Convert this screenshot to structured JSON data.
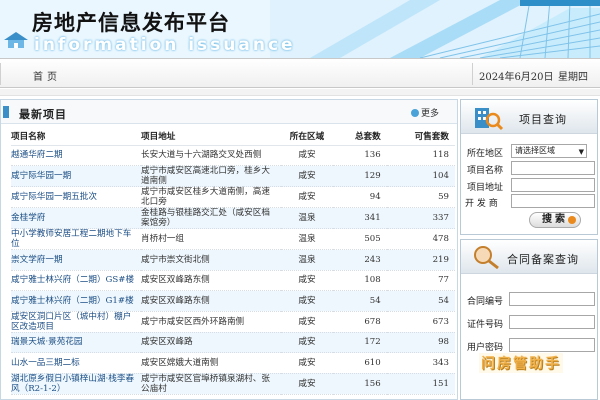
{
  "banner": {
    "title": "房地产信息发布平台",
    "subtitle": "information issuance"
  },
  "nav": {
    "home": "首页",
    "date": "2024年6月20日",
    "weekday": "星期四"
  },
  "projects": {
    "title": "最新项目",
    "more": "更多",
    "columns": [
      "项目名称",
      "项目地址",
      "所在区域",
      "总套数",
      "可售套数"
    ],
    "rows": [
      {
        "name": "越通华府二期",
        "address": "长安大道与十六湖路交叉处西侧",
        "district": "咸安",
        "total": "136",
        "available": "118"
      },
      {
        "name": "咸宁际华园一期",
        "address": "咸宁市咸安区高速北口旁，桂乡大道南侧",
        "district": "咸安",
        "total": "129",
        "available": "104"
      },
      {
        "name": "咸宁际华园一期五批次",
        "address": "咸宁市咸安区桂乡大道南侧，高速北口旁",
        "district": "咸安",
        "total": "94",
        "available": "59"
      },
      {
        "name": "金桂学府",
        "address": "金桂路与银桂路交汇处（咸安区档案馆旁）",
        "district": "温泉",
        "total": "341",
        "available": "337"
      },
      {
        "name": "中小学教师安居工程二期地下车位",
        "address": "肖桥村一组",
        "district": "温泉",
        "total": "505",
        "available": "478"
      },
      {
        "name": "崇文学府一期",
        "address": "咸宁市崇文街北侧",
        "district": "温泉",
        "total": "243",
        "available": "219"
      },
      {
        "name": "咸宁雅士林兴府（二期）GS#楼",
        "address": "咸安区双峰路东侧",
        "district": "咸安",
        "total": "108",
        "available": "77"
      },
      {
        "name": "咸宁雅士林兴府（二期）G1#楼",
        "address": "咸安区双峰路东侧",
        "district": "咸安",
        "total": "54",
        "available": "54"
      },
      {
        "name": "咸安区洞口片区（城中村）棚户区改造项目",
        "address": "咸宁市咸安区西外环路南侧",
        "district": "咸安",
        "total": "678",
        "available": "673"
      },
      {
        "name": "瑞景天城·景苑花园",
        "address": "咸安区双峰路",
        "district": "咸安",
        "total": "172",
        "available": "98"
      },
      {
        "name": "山水一品三期二标",
        "address": "咸安区嫦娥大道南侧",
        "district": "咸安",
        "total": "610",
        "available": "343"
      },
      {
        "name": "湖北原乡假日小镇梓山湖·栈李春风（R2-1-2）",
        "address": "咸宁市咸安区官埠桥镇泉湖村、张公庙村",
        "district": "咸安",
        "total": "156",
        "available": "151"
      }
    ]
  },
  "project_query": {
    "title": "项目查询",
    "district_label": "所在地区",
    "district_value": "请选择区域",
    "name_label": "项目名称",
    "address_label": "项目地址",
    "developer_label": "开 发 商",
    "search_button": "搜索"
  },
  "contract_query": {
    "title": "合同备案查询",
    "contract_label": "合同编号",
    "id_label": "证件号码",
    "account_label": "用户密码",
    "watermark": "问房管助手"
  },
  "colors": {
    "accent": "#3b8fc9",
    "link": "#1d4f86",
    "row_alt": "#eef7fd",
    "button_dot": "#ea8a1c"
  }
}
